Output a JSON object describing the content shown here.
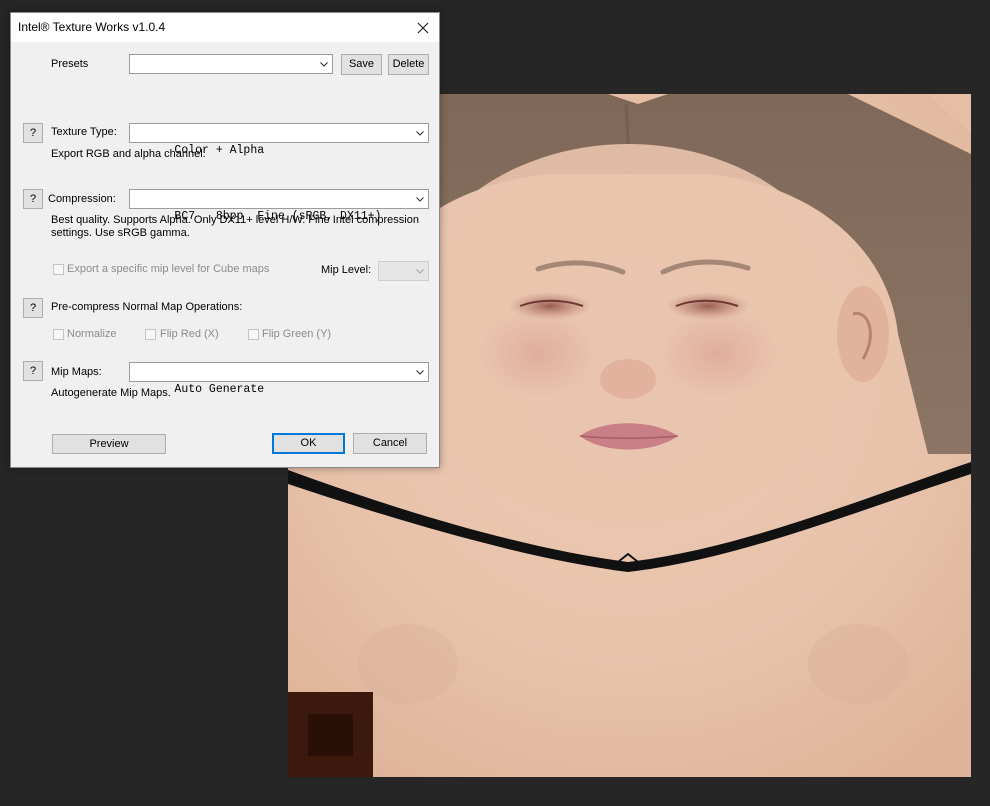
{
  "dialog": {
    "title": "Intel® Texture Works v1.0.4",
    "presets": {
      "label": "Presets",
      "value": "",
      "save_label": "Save",
      "delete_label": "Delete"
    },
    "texture_type": {
      "help": "?",
      "label": "Texture Type:",
      "value": "Color + Alpha",
      "description": "Export RGB and alpha channel."
    },
    "compression": {
      "help": "?",
      "label": "Compression:",
      "value": "BC7   8bpp  Fine (sRGB, DX11+)",
      "description_line1": "Best quality. Supports Alpha. Only DX11+ level H/W. Fine Intel compression",
      "description_line2": "settings. Use sRGB gamma."
    },
    "cube": {
      "checkbox_label": "Export a specific mip level for Cube maps",
      "checked": false,
      "mip_level_label": "Mip Level:",
      "mip_level_value": ""
    },
    "normal_map": {
      "help": "?",
      "label": "Pre-compress Normal Map Operations:",
      "normalize_label": "Normalize",
      "flip_red_label": "Flip Red (X)",
      "flip_green_label": "Flip Green (Y)"
    },
    "mip_maps": {
      "help": "?",
      "label": "Mip Maps:",
      "value": "Auto Generate",
      "description": "Autogenerate Mip Maps."
    },
    "buttons": {
      "preview": "Preview",
      "ok": "OK",
      "cancel": "Cancel"
    }
  },
  "colors": {
    "canvas_background": "#262626",
    "dialog_background": "#f0f0f0",
    "default_button_border": "#0078d7",
    "skin": "#e7c2ab",
    "hair": "#8a7262"
  }
}
